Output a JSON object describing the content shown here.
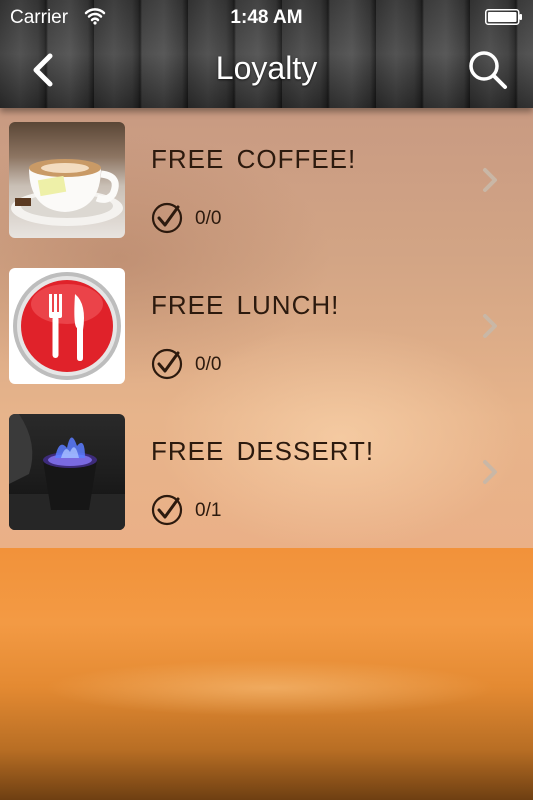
{
  "status_bar": {
    "carrier": "Carrier",
    "time": "1:48 AM"
  },
  "nav": {
    "title": "Loyalty",
    "back_icon": "chevron-left-icon",
    "search_icon": "search-icon"
  },
  "rewards": [
    {
      "title": "FREE  COFFEE!",
      "count": "0/0",
      "image": "coffee-cup"
    },
    {
      "title": "FREE  LUNCH!",
      "count": "0/0",
      "image": "fork-knife-icon"
    },
    {
      "title": "FREE  DESSERT!",
      "count": "0/1",
      "image": "flaming-dessert"
    }
  ],
  "colors": {
    "nav_text": "#ffffff",
    "row_text": "#2c1a0e",
    "chevron": "#c9b7a6",
    "lunch_red": "#e0222a"
  }
}
